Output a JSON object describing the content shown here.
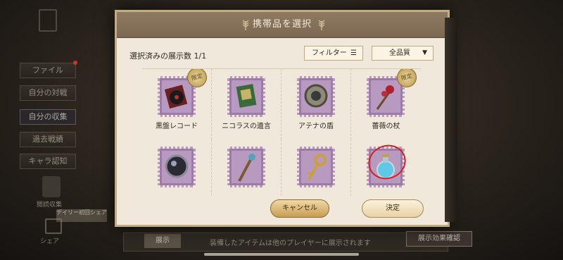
{
  "sidebar": {
    "items": [
      {
        "label": "ファイル"
      },
      {
        "label": "自分の対戦"
      },
      {
        "label": "自分の収集"
      },
      {
        "label": "過去戦績"
      },
      {
        "label": "キャラ認知"
      }
    ],
    "book_label": "閲読収集",
    "daily_label": "デイリー初回シェア",
    "share_label": "シェア"
  },
  "underlay": {
    "tab_label": "展示",
    "description": "装備したアイテムは他のプレイヤーに展示されます",
    "button_label": "展示効果確認"
  },
  "dialog": {
    "title": "携帯品を選択",
    "selected_count": "選択済みの展示数 1/1",
    "filter_label": "フィルター",
    "grade_label": "全品質",
    "limited_badge": "限定",
    "items": [
      {
        "name": "黒盤レコード",
        "limited": true,
        "icon": "record-icon"
      },
      {
        "name": "ニコラスの遺言",
        "limited": false,
        "icon": "book-icon"
      },
      {
        "name": "アテナの盾",
        "limited": false,
        "icon": "shield-icon"
      },
      {
        "name": "薔薇の杖",
        "limited": true,
        "icon": "rose-staff-icon"
      },
      {
        "name": "",
        "limited": false,
        "icon": "dark-orb-icon"
      },
      {
        "name": "",
        "limited": false,
        "icon": "staff-icon"
      },
      {
        "name": "",
        "limited": false,
        "icon": "key-icon"
      },
      {
        "name": "",
        "limited": false,
        "icon": "potion-icon",
        "selected": true
      }
    ],
    "cancel_label": "キャンセル",
    "confirm_label": "決定"
  }
}
